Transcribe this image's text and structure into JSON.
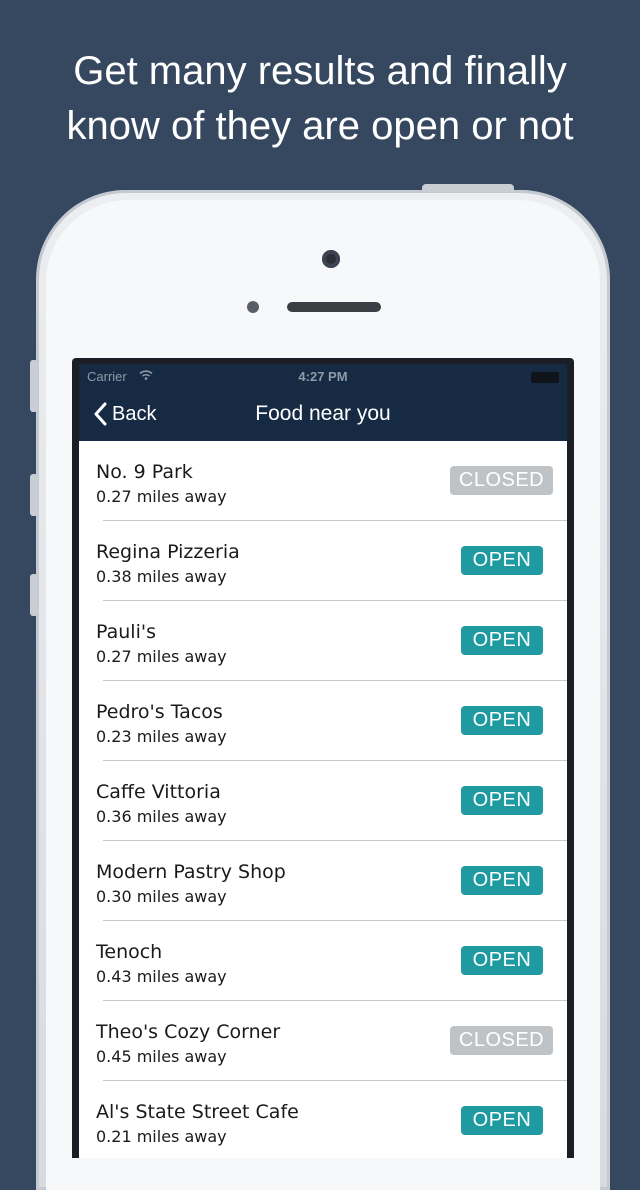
{
  "headline": {
    "line1": "Get many results and finally",
    "line2": "know of they are open or not"
  },
  "status_bar": {
    "carrier": "Carrier",
    "time": "4:27 PM"
  },
  "nav": {
    "back_label": "Back",
    "title": "Food near you"
  },
  "places": [
    {
      "name": "No. 9 Park",
      "distance": "0.27 miles away",
      "status": "CLOSED"
    },
    {
      "name": "Regina Pizzeria",
      "distance": "0.38 miles away",
      "status": "OPEN"
    },
    {
      "name": "Pauli's",
      "distance": "0.27 miles away",
      "status": "OPEN"
    },
    {
      "name": "Pedro's Tacos",
      "distance": "0.23 miles away",
      "status": "OPEN"
    },
    {
      "name": "Caffe Vittoria",
      "distance": "0.36 miles away",
      "status": "OPEN"
    },
    {
      "name": "Modern Pastry Shop",
      "distance": "0.30 miles away",
      "status": "OPEN"
    },
    {
      "name": "Tenoch",
      "distance": "0.43 miles away",
      "status": "OPEN"
    },
    {
      "name": "Theo's Cozy Corner",
      "distance": "0.45 miles away",
      "status": "CLOSED"
    },
    {
      "name": "Al's State Street Cafe",
      "distance": "0.21 miles away",
      "status": "OPEN"
    }
  ],
  "colors": {
    "background": "#35485f",
    "nav_bar": "#172a44",
    "open_badge": "#1f9aa0",
    "closed_badge": "#bfc3c6"
  }
}
